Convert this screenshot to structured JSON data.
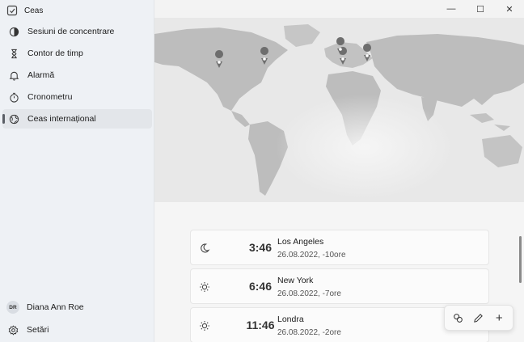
{
  "app": {
    "title": "Ceas"
  },
  "sidebar": {
    "items": [
      {
        "label": "Sesiuni de concentrare",
        "icon": "focus-icon"
      },
      {
        "label": "Contor de timp",
        "icon": "hourglass-icon"
      },
      {
        "label": "Alarmă",
        "icon": "bell-icon"
      },
      {
        "label": "Cronometru",
        "icon": "stopwatch-icon"
      },
      {
        "label": "Ceas internațional",
        "icon": "globe-icon",
        "active": true
      }
    ],
    "user": {
      "initials": "DR",
      "name": "Diana Ann Roe"
    },
    "settings_label": "Setări"
  },
  "window_controls": {
    "minimize": "—",
    "maximize": "☐",
    "close": "✕"
  },
  "clocks": [
    {
      "time": "3:46",
      "city": "Los Angeles",
      "meta": "26.08.2022, -10ore",
      "icon": "moon-icon"
    },
    {
      "time": "6:46",
      "city": "New York",
      "meta": "26.08.2022, -7ore",
      "icon": "sun-icon"
    },
    {
      "time": "11:46",
      "city": "Londra",
      "meta": "26.08.2022, -2ore",
      "icon": "sun-icon"
    }
  ],
  "toolbar": {
    "compare": "compare-icon",
    "edit": "pencil-icon",
    "add": "+"
  },
  "colors": {
    "sidebar_bg": "#eef1f5",
    "map_land": "#bdbdbd",
    "map_bg": "#e9e9e9",
    "pin": "#6e6e6e"
  }
}
